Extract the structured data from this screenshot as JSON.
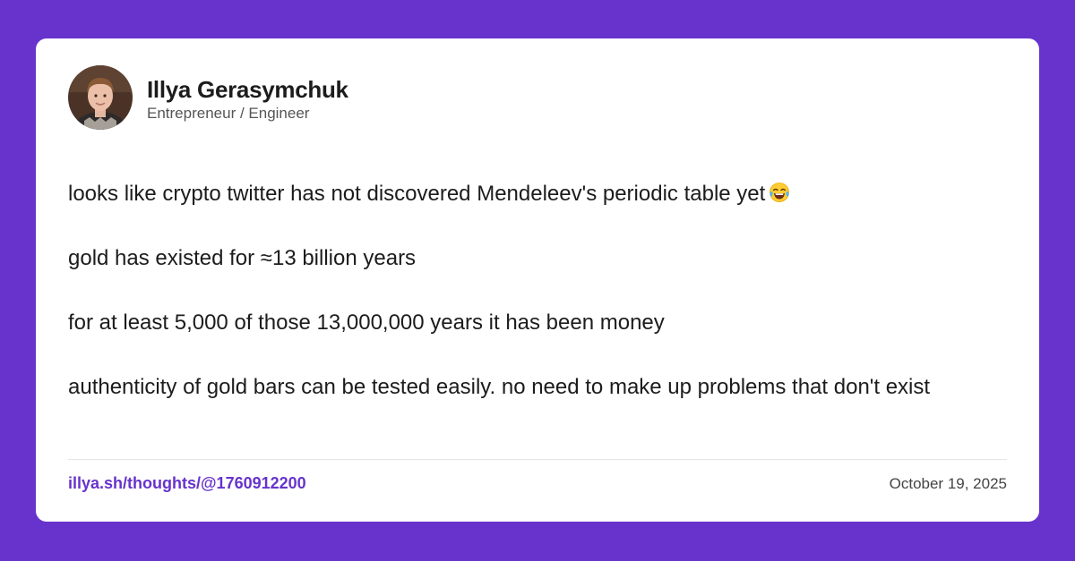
{
  "author": {
    "name": "Illya Gerasymchuk",
    "role": "Entrepreneur / Engineer"
  },
  "post": {
    "paragraphs": [
      "looks like crypto twitter has not discovered Mendeleev's periodic table yet",
      "gold has existed for ≈13 billion years",
      "for at least 5,000 of those 13,000,000 years it has been money",
      "authenticity of gold bars can be tested easily. no need to make up problems that don't exist"
    ],
    "emoji": "face-with-tears-of-joy-icon"
  },
  "footer": {
    "permalink": "illya.sh/thoughts/@1760912200",
    "date": "October 19, 2025"
  },
  "colors": {
    "background": "#6733cc",
    "card": "#ffffff",
    "link": "#6733cc",
    "text": "#1c1c1c"
  }
}
